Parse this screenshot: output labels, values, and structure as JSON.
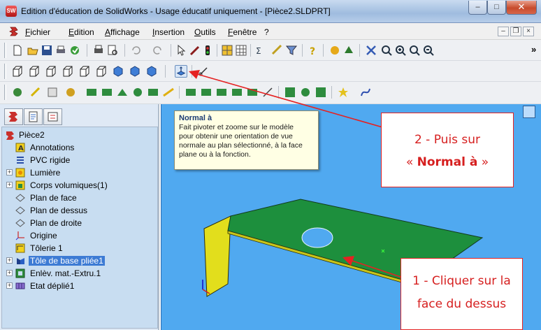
{
  "window": {
    "title": "Edition d'éducation de SolidWorks - Usage éducatif uniquement - [Pièce2.SLDPRT]",
    "min_symbol": "–",
    "max_symbol": "□",
    "close_symbol": "✕"
  },
  "menu": {
    "items": [
      "Fichier",
      "Edition",
      "Affichage",
      "Insertion",
      "Outils",
      "Fenêtre",
      "?"
    ],
    "mdi_min": "–",
    "mdi_restore": "❐",
    "mdi_close": "×"
  },
  "toolbar": {
    "overflow": "»"
  },
  "tree": {
    "root": "Pièce2",
    "items": [
      {
        "label": "Annotations",
        "icon": "annotations-icon",
        "expandable": false
      },
      {
        "label": "PVC rigide",
        "icon": "material-icon",
        "expandable": false
      },
      {
        "label": "Lumière",
        "icon": "lights-icon",
        "expandable": true
      },
      {
        "label": "Corps volumiques(1)",
        "icon": "solid-bodies-icon",
        "expandable": true
      },
      {
        "label": "Plan de face",
        "icon": "plane-icon",
        "expandable": false
      },
      {
        "label": "Plan de dessus",
        "icon": "plane-icon",
        "expandable": false
      },
      {
        "label": "Plan de droite",
        "icon": "plane-icon",
        "expandable": false
      },
      {
        "label": "Origine",
        "icon": "origin-icon",
        "expandable": false
      },
      {
        "label": "Tôlerie 1",
        "icon": "sheet-metal-icon",
        "expandable": false
      },
      {
        "label": "Tôle de base pliée1",
        "icon": "base-flange-icon",
        "expandable": true,
        "selected": true
      },
      {
        "label": "Enlèv. mat.-Extru.1",
        "icon": "extruded-cut-icon",
        "expandable": true
      },
      {
        "label": "Etat déplié1",
        "icon": "flat-pattern-icon",
        "expandable": true
      }
    ]
  },
  "tooltip": {
    "title": "Normal à",
    "line1": "Fait pivoter et zoome sur le modèle",
    "line2": "pour obtenir une orientation de vue",
    "line3": "normale au plan sélectionné, à la face",
    "line4": "plane ou à la fonction."
  },
  "annotations": {
    "step2_line1": "2 - Puis sur",
    "step2_line2_prefix": "« ",
    "step2_line2_bold": "Normal à",
    "step2_line2_suffix": " »",
    "step1_line1": "1 - Cliquer sur la",
    "step1_line2": "face du dessus"
  },
  "colors": {
    "viewport_background": "#50a9f0",
    "part_face": "#1d8f3d",
    "part_edge_face": "#e4e11d",
    "annotation_red": "#e52222",
    "tree_background": "#c8ddf1"
  }
}
